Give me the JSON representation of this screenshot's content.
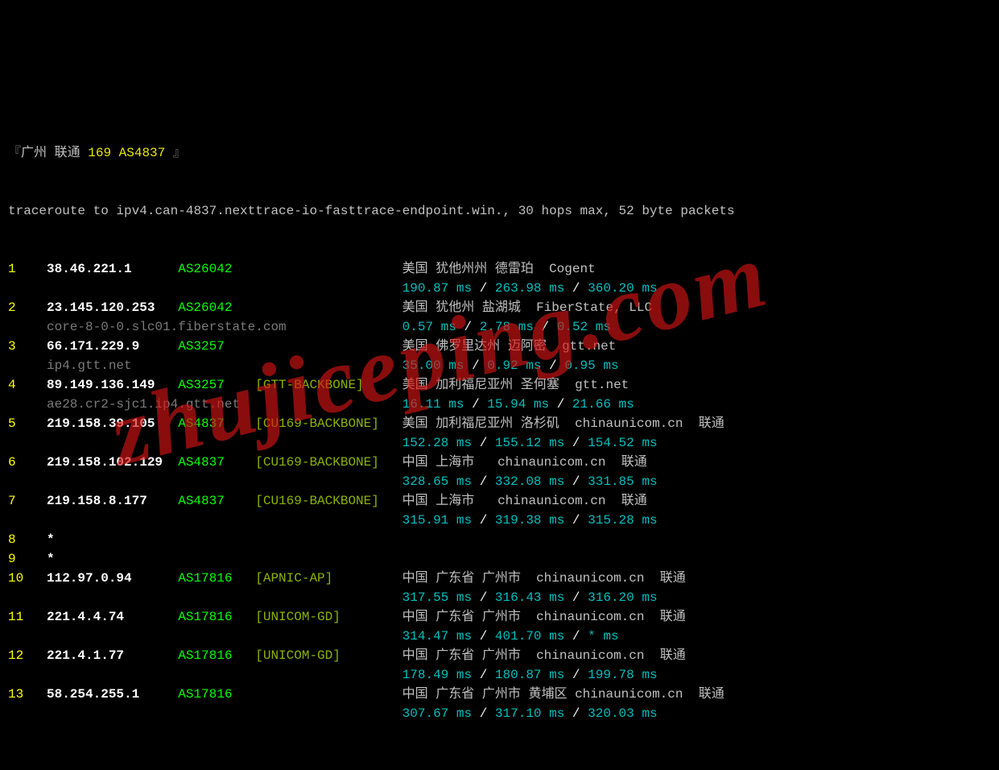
{
  "watermark": "zhujiceping.com",
  "header": {
    "open_bracket": "『",
    "city_isp": "广州 联通",
    "as_info": "169 AS4837",
    "close_bracket": "』"
  },
  "cmdline": "traceroute to ipv4.can-4837.nexttrace-io-fasttrace-endpoint.win., 30 hops max, 52 byte packets",
  "hops": [
    {
      "n": "1",
      "ip": "38.46.221.1",
      "asn": "AS26042",
      "tag": "",
      "desc": "美国 犹他州州 德雷珀  Cogent",
      "host": "",
      "lat": [
        "190.87 ms",
        "263.98 ms",
        "360.20 ms"
      ]
    },
    {
      "n": "2",
      "ip": "23.145.120.253",
      "asn": "AS26042",
      "tag": "",
      "desc": "美国 犹他州 盐湖城  FiberState, LLC",
      "host": "core-8-0-0.slc01.fiberstate.com",
      "lat": [
        "0.57 ms",
        "2.78 ms",
        "0.52 ms"
      ]
    },
    {
      "n": "3",
      "ip": "66.171.229.9",
      "asn": "AS3257",
      "tag": "",
      "desc": "美国 佛罗里达州 迈阿密  gtt.net",
      "host": "ip4.gtt.net",
      "lat": [
        "35.00 ms",
        "0.92 ms",
        "0.95 ms"
      ]
    },
    {
      "n": "4",
      "ip": "89.149.136.149",
      "asn": "AS3257",
      "tag": "[GTT-BACKBONE]",
      "desc": "美国 加利福尼亚州 圣何塞  gtt.net",
      "host": "ae28.cr2-sjc1.ip4.gtt.net",
      "lat": [
        "16.11 ms",
        "15.94 ms",
        "21.66 ms"
      ]
    },
    {
      "n": "5",
      "ip": "219.158.39.105",
      "asn": "AS4837",
      "tag": "[CU169-BACKBONE]",
      "desc": "美国 加利福尼亚州 洛杉矶  chinaunicom.cn  联通",
      "host": "",
      "lat": [
        "152.28 ms",
        "155.12 ms",
        "154.52 ms"
      ]
    },
    {
      "n": "6",
      "ip": "219.158.102.129",
      "asn": "AS4837",
      "tag": "[CU169-BACKBONE]",
      "desc": "中国 上海市   chinaunicom.cn  联通",
      "host": "",
      "lat": [
        "328.65 ms",
        "332.08 ms",
        "331.85 ms"
      ]
    },
    {
      "n": "7",
      "ip": "219.158.8.177",
      "asn": "AS4837",
      "tag": "[CU169-BACKBONE]",
      "desc": "中国 上海市   chinaunicom.cn  联通",
      "host": "",
      "lat": [
        "315.91 ms",
        "319.38 ms",
        "315.28 ms"
      ]
    },
    {
      "n": "8",
      "ip": "*",
      "asn": "",
      "tag": "",
      "desc": "",
      "host": "",
      "lat": []
    },
    {
      "n": "9",
      "ip": "*",
      "asn": "",
      "tag": "",
      "desc": "",
      "host": "",
      "lat": []
    },
    {
      "n": "10",
      "ip": "112.97.0.94",
      "asn": "AS17816",
      "tag": "[APNIC-AP]",
      "desc": "中国 广东省 广州市  chinaunicom.cn  联通",
      "host": "",
      "lat": [
        "317.55 ms",
        "316.43 ms",
        "316.20 ms"
      ]
    },
    {
      "n": "11",
      "ip": "221.4.4.74",
      "asn": "AS17816",
      "tag": "[UNICOM-GD]",
      "desc": "中国 广东省 广州市  chinaunicom.cn  联通",
      "host": "",
      "lat": [
        "314.47 ms",
        "401.70 ms",
        "* ms"
      ]
    },
    {
      "n": "12",
      "ip": "221.4.1.77",
      "asn": "AS17816",
      "tag": "[UNICOM-GD]",
      "desc": "中国 广东省 广州市  chinaunicom.cn  联通",
      "host": "",
      "lat": [
        "178.49 ms",
        "180.87 ms",
        "199.78 ms"
      ]
    },
    {
      "n": "13",
      "ip": "58.254.255.1",
      "asn": "AS17816",
      "tag": "",
      "desc": "中国 广东省 广州市 黄埔区 chinaunicom.cn  联通",
      "host": "",
      "lat": [
        "307.67 ms",
        "317.10 ms",
        "320.03 ms"
      ]
    }
  ]
}
